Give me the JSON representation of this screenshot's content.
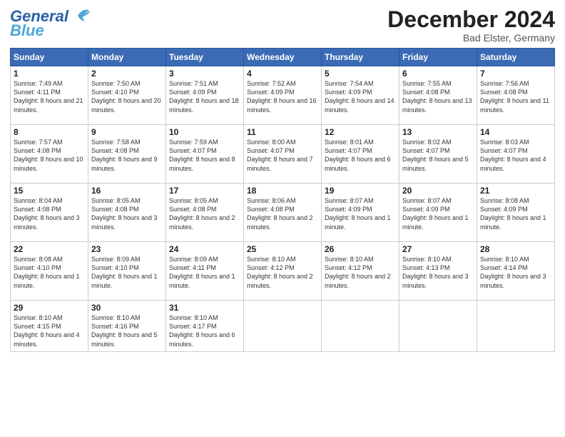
{
  "header": {
    "logo_line1": "General",
    "logo_line2": "Blue",
    "month": "December 2024",
    "location": "Bad Elster, Germany"
  },
  "days_of_week": [
    "Sunday",
    "Monday",
    "Tuesday",
    "Wednesday",
    "Thursday",
    "Friday",
    "Saturday"
  ],
  "weeks": [
    [
      {
        "day": 1,
        "sunrise": "7:49 AM",
        "sunset": "4:11 PM",
        "daylight": "8 hours and 21 minutes."
      },
      {
        "day": 2,
        "sunrise": "7:50 AM",
        "sunset": "4:10 PM",
        "daylight": "8 hours and 20 minutes."
      },
      {
        "day": 3,
        "sunrise": "7:51 AM",
        "sunset": "4:09 PM",
        "daylight": "8 hours and 18 minutes."
      },
      {
        "day": 4,
        "sunrise": "7:52 AM",
        "sunset": "4:09 PM",
        "daylight": "8 hours and 16 minutes."
      },
      {
        "day": 5,
        "sunrise": "7:54 AM",
        "sunset": "4:09 PM",
        "daylight": "8 hours and 14 minutes."
      },
      {
        "day": 6,
        "sunrise": "7:55 AM",
        "sunset": "4:08 PM",
        "daylight": "8 hours and 13 minutes."
      },
      {
        "day": 7,
        "sunrise": "7:56 AM",
        "sunset": "4:08 PM",
        "daylight": "8 hours and 11 minutes."
      }
    ],
    [
      {
        "day": 8,
        "sunrise": "7:57 AM",
        "sunset": "4:08 PM",
        "daylight": "8 hours and 10 minutes."
      },
      {
        "day": 9,
        "sunrise": "7:58 AM",
        "sunset": "4:08 PM",
        "daylight": "8 hours and 9 minutes."
      },
      {
        "day": 10,
        "sunrise": "7:59 AM",
        "sunset": "4:07 PM",
        "daylight": "8 hours and 8 minutes."
      },
      {
        "day": 11,
        "sunrise": "8:00 AM",
        "sunset": "4:07 PM",
        "daylight": "8 hours and 7 minutes."
      },
      {
        "day": 12,
        "sunrise": "8:01 AM",
        "sunset": "4:07 PM",
        "daylight": "8 hours and 6 minutes."
      },
      {
        "day": 13,
        "sunrise": "8:02 AM",
        "sunset": "4:07 PM",
        "daylight": "8 hours and 5 minutes."
      },
      {
        "day": 14,
        "sunrise": "8:03 AM",
        "sunset": "4:07 PM",
        "daylight": "8 hours and 4 minutes."
      }
    ],
    [
      {
        "day": 15,
        "sunrise": "8:04 AM",
        "sunset": "4:08 PM",
        "daylight": "8 hours and 3 minutes."
      },
      {
        "day": 16,
        "sunrise": "8:05 AM",
        "sunset": "4:08 PM",
        "daylight": "8 hours and 3 minutes."
      },
      {
        "day": 17,
        "sunrise": "8:05 AM",
        "sunset": "4:08 PM",
        "daylight": "8 hours and 2 minutes."
      },
      {
        "day": 18,
        "sunrise": "8:06 AM",
        "sunset": "4:08 PM",
        "daylight": "8 hours and 2 minutes."
      },
      {
        "day": 19,
        "sunrise": "8:07 AM",
        "sunset": "4:09 PM",
        "daylight": "8 hours and 1 minute."
      },
      {
        "day": 20,
        "sunrise": "8:07 AM",
        "sunset": "4:09 PM",
        "daylight": "8 hours and 1 minute."
      },
      {
        "day": 21,
        "sunrise": "8:08 AM",
        "sunset": "4:09 PM",
        "daylight": "8 hours and 1 minute."
      }
    ],
    [
      {
        "day": 22,
        "sunrise": "8:08 AM",
        "sunset": "4:10 PM",
        "daylight": "8 hours and 1 minute."
      },
      {
        "day": 23,
        "sunrise": "8:09 AM",
        "sunset": "4:10 PM",
        "daylight": "8 hours and 1 minute."
      },
      {
        "day": 24,
        "sunrise": "8:09 AM",
        "sunset": "4:11 PM",
        "daylight": "8 hours and 1 minute."
      },
      {
        "day": 25,
        "sunrise": "8:10 AM",
        "sunset": "4:12 PM",
        "daylight": "8 hours and 2 minutes."
      },
      {
        "day": 26,
        "sunrise": "8:10 AM",
        "sunset": "4:12 PM",
        "daylight": "8 hours and 2 minutes."
      },
      {
        "day": 27,
        "sunrise": "8:10 AM",
        "sunset": "4:13 PM",
        "daylight": "8 hours and 3 minutes."
      },
      {
        "day": 28,
        "sunrise": "8:10 AM",
        "sunset": "4:14 PM",
        "daylight": "8 hours and 3 minutes."
      }
    ],
    [
      {
        "day": 29,
        "sunrise": "8:10 AM",
        "sunset": "4:15 PM",
        "daylight": "8 hours and 4 minutes."
      },
      {
        "day": 30,
        "sunrise": "8:10 AM",
        "sunset": "4:16 PM",
        "daylight": "8 hours and 5 minutes."
      },
      {
        "day": 31,
        "sunrise": "8:10 AM",
        "sunset": "4:17 PM",
        "daylight": "8 hours and 6 minutes."
      },
      null,
      null,
      null,
      null
    ]
  ]
}
